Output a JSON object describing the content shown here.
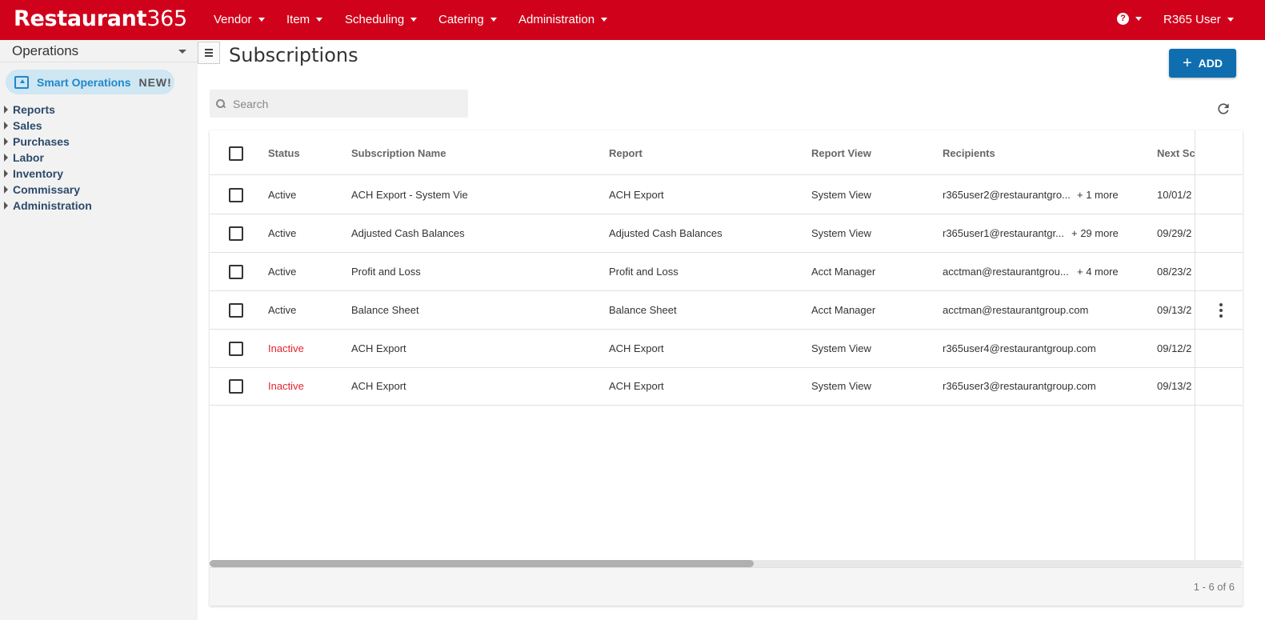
{
  "brand": {
    "name": "Restaurant",
    "suffix": "365"
  },
  "nav": {
    "items": [
      "Vendor",
      "Item",
      "Scheduling",
      "Catering",
      "Administration"
    ],
    "help_glyph": "?",
    "user": "R365 User"
  },
  "sidebar": {
    "title": "Operations",
    "smart": {
      "label": "Smart Operations",
      "badge": "NEW!"
    },
    "items": [
      "Reports",
      "Sales",
      "Purchases",
      "Labor",
      "Inventory",
      "Commissary",
      "Administration"
    ]
  },
  "page": {
    "title": "Subscriptions",
    "add_label": "ADD",
    "search_placeholder": "Search"
  },
  "table": {
    "columns": [
      "Status",
      "Subscription Name",
      "Report",
      "Report View",
      "Recipients",
      "Next Sch"
    ],
    "rows": [
      {
        "status": "Active",
        "name": "ACH Export - System Vie",
        "report": "ACH Export",
        "view": "System View",
        "recipients": "r365user2@restaurantgro...",
        "more": "+ 1 more",
        "next": "10/01/2"
      },
      {
        "status": "Active",
        "name": "Adjusted Cash Balances",
        "report": "Adjusted Cash Balances",
        "view": "System View",
        "recipients": "r365user1@restaurantgr...",
        "more": "+ 29 more",
        "next": "09/29/2"
      },
      {
        "status": "Active",
        "name": "Profit and Loss",
        "report": "Profit and Loss",
        "view": "Acct Manager",
        "recipients": "acctman@restaurantgrou...",
        "more": "+ 4 more",
        "next": "08/23/2"
      },
      {
        "status": "Active",
        "name": "Balance Sheet",
        "report": "Balance Sheet",
        "view": "Acct Manager",
        "recipients": "acctman@restaurantgroup.com",
        "more": "",
        "next": "09/13/2"
      },
      {
        "status": "Inactive",
        "name": "ACH Export",
        "report": "ACH Export",
        "view": "System View",
        "recipients": "r365user4@restaurantgroup.com",
        "more": "",
        "next": "09/12/2"
      },
      {
        "status": "Inactive",
        "name": "ACH Export",
        "report": "ACH Export",
        "view": "System View",
        "recipients": "r365user3@restaurantgroup.com",
        "more": "",
        "next": "09/13/2"
      }
    ],
    "pager": "1 - 6 of 6"
  },
  "icons": {
    "nav_caret": "chevron-down-icon",
    "search": "search-icon",
    "refresh": "refresh-icon",
    "row_menu": "more-vertical-icon",
    "sidebar_toggle": "menu-icon",
    "smart_ops": "upload-box-icon"
  },
  "colors": {
    "brand_red": "#d0021b",
    "primary_blue": "#0f6eb0",
    "smart_bg": "#cfe6f3",
    "inactive_red": "#e0252c",
    "sidebar_bg": "#f2f2f2"
  }
}
